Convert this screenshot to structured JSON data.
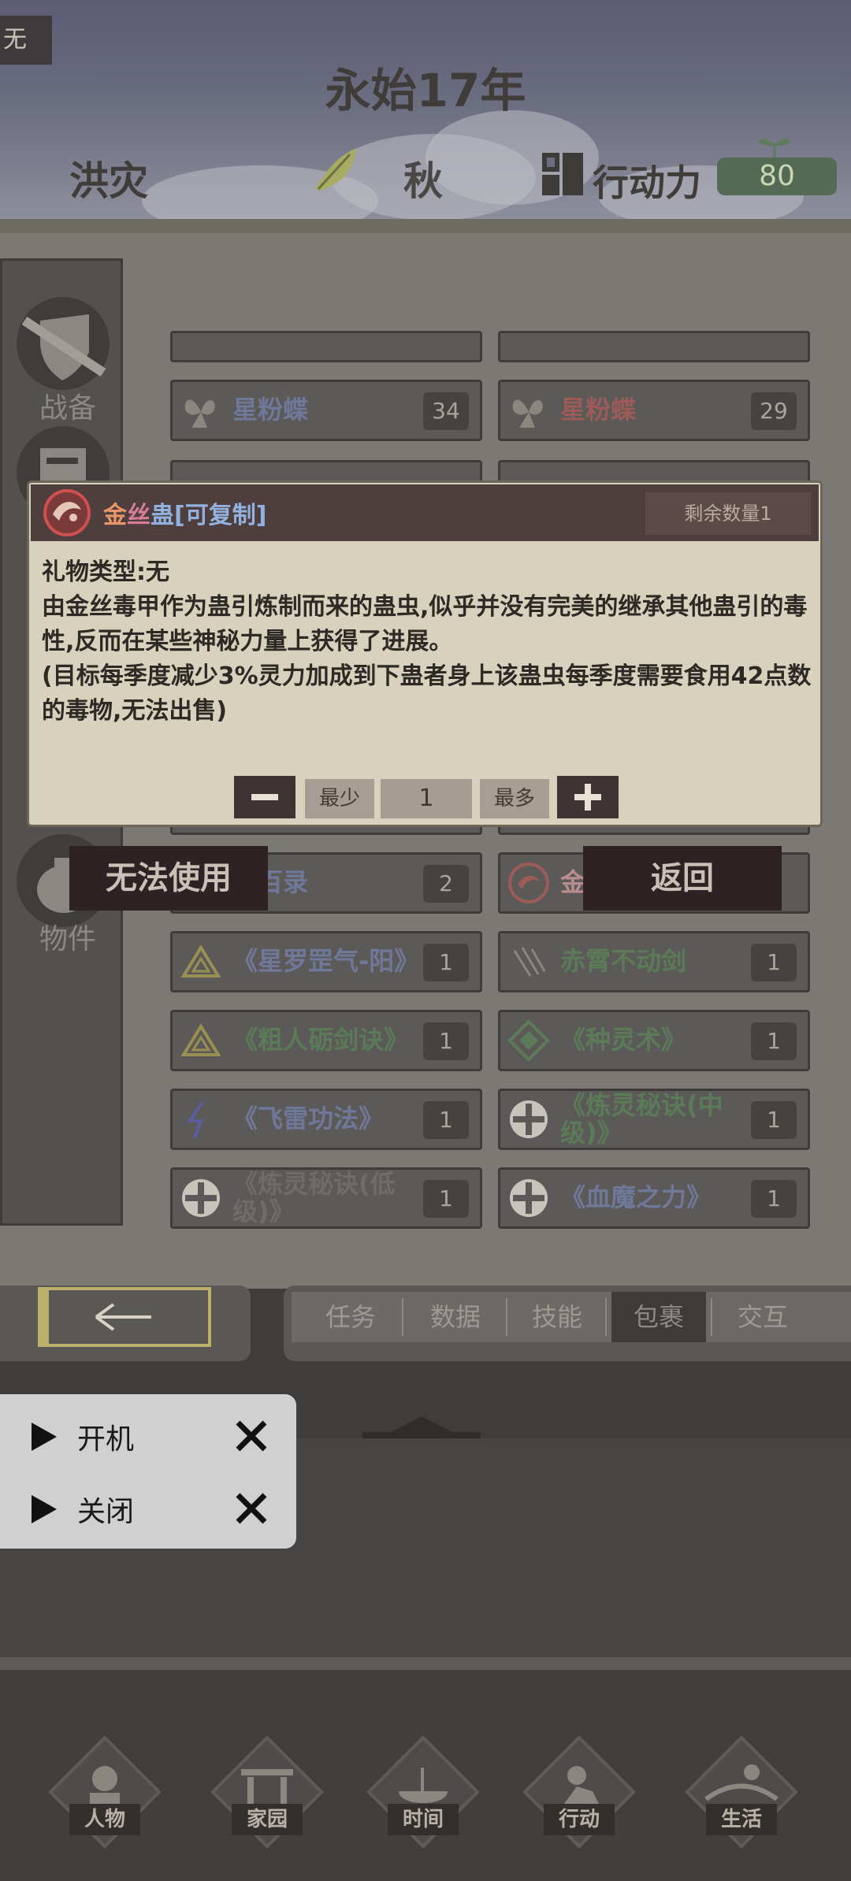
{
  "header": {
    "corner_tag": "无",
    "year_title": "永始17年",
    "disaster": "洪灾",
    "season": "秋",
    "action_points_label": "行动力",
    "action_points_value": "80"
  },
  "sidebar": {
    "items": [
      {
        "label": "战备",
        "icon": "sword-shield-icon"
      },
      {
        "label": "物件",
        "icon": "bag-icon"
      }
    ]
  },
  "inventory": {
    "items": [
      {
        "name": "星粉蝶",
        "count": "34",
        "icon": "butterfly-icon",
        "color": "#70789a"
      },
      {
        "name": "星粉蝶",
        "count": "29",
        "icon": "butterfly-icon",
        "color": "#9c5a58"
      },
      {
        "name": "蛊百录",
        "count": "2",
        "icon": "book-icon",
        "color": "#70789a"
      },
      {
        "name": "金",
        "count": "",
        "icon": "gu-insect-icon",
        "color": "#b98d8f"
      },
      {
        "name": "《星罗罡气-阳》",
        "count": "1",
        "icon": "triangle-rune-icon",
        "color": "#70789a"
      },
      {
        "name": "赤霄不动剑",
        "count": "1",
        "icon": "claw-icon",
        "color": "#5b7a57"
      },
      {
        "name": "《粗人砺剑诀》",
        "count": "1",
        "icon": "triangle-rune-icon",
        "color": "#5b7a57"
      },
      {
        "name": "《种灵术》",
        "count": "1",
        "icon": "diamond-rune-icon",
        "color": "#5b7a57"
      },
      {
        "name": "《飞雷功法》",
        "count": "1",
        "icon": "lightning-icon",
        "color": "#70789a"
      },
      {
        "name": "《炼灵秘诀(中级)》",
        "count": "1",
        "icon": "cross-circle-icon",
        "color": "#5b7a57"
      },
      {
        "name": "《炼灵秘诀(低级)》",
        "count": "1",
        "icon": "cross-circle-icon",
        "color": "#6e6c68"
      },
      {
        "name": "《血魔之力》",
        "count": "1",
        "icon": "cross-circle-icon",
        "color": "#70789a"
      }
    ]
  },
  "popup": {
    "title_part1": "金",
    "title_part2": "丝",
    "title_part3": "蛊[可复制]",
    "remaining": "剩余数量1",
    "gift_type": "礼物类型:无",
    "description": "由金丝毒甲作为蛊引炼制而来的蛊虫,似乎并没有完美的继承其他蛊引的毒性,反而在某些神秘力量上获得了进展。",
    "effect": "(目标每季度减少3%灵力加成到下蛊者身上该蛊虫每季度需要食用42点数的毒物,无法出售)",
    "min_label": "最少",
    "max_label": "最多",
    "quantity": "1"
  },
  "actions": {
    "cannot_use": "无法使用",
    "back": "返回"
  },
  "tabs": [
    "任务",
    "数据",
    "技能",
    "包裹",
    "交互"
  ],
  "active_tab": "包裹",
  "bottom_nav": [
    {
      "label": "人物",
      "icon": "person-icon"
    },
    {
      "label": "家园",
      "icon": "gate-icon"
    },
    {
      "label": "时间",
      "icon": "incense-icon"
    },
    {
      "label": "行动",
      "icon": "action-icon"
    },
    {
      "label": "生活",
      "icon": "landscape-icon"
    }
  ],
  "control_menu": {
    "start": "开机",
    "close": "关闭"
  },
  "colors": {
    "popup_header": "#4e3e3d",
    "popup_body": "#d7d1bd",
    "ap_badge": "#556a54",
    "action_button": "#2e2224"
  }
}
